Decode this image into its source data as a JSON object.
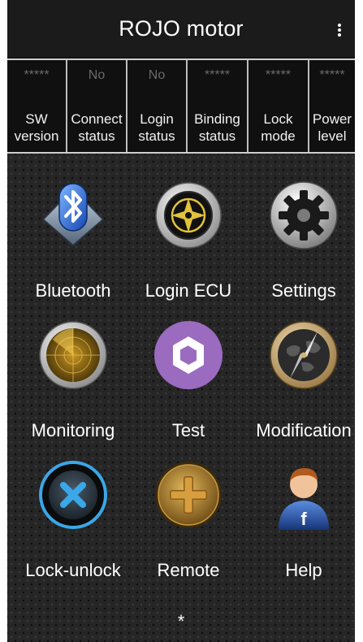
{
  "app": {
    "title": "ROJO motor"
  },
  "status": [
    {
      "value": "*****",
      "label_line1": "SW",
      "label_line2": "version"
    },
    {
      "value": "No",
      "label_line1": "Connect",
      "label_line2": "status"
    },
    {
      "value": "No",
      "label_line1": "Login",
      "label_line2": "status"
    },
    {
      "value": "*****",
      "label_line1": "Binding",
      "label_line2": "status"
    },
    {
      "value": "*****",
      "label_line1": "Lock",
      "label_line2": "mode"
    },
    {
      "value": "*****",
      "label_line1": "Power",
      "label_line2": "level"
    }
  ],
  "menu": [
    {
      "label": "Bluetooth",
      "icon": "bluetooth-icon"
    },
    {
      "label": "Login ECU",
      "icon": "compass-target-icon"
    },
    {
      "label": "Settings",
      "icon": "gear-icon"
    },
    {
      "label": "Monitoring",
      "icon": "radar-icon"
    },
    {
      "label": "Test",
      "icon": "aperture-icon"
    },
    {
      "label": "Modification",
      "icon": "world-compass-icon"
    },
    {
      "label": "Lock-unlock",
      "icon": "x-circle-icon"
    },
    {
      "label": "Remote",
      "icon": "plus-circle-icon"
    },
    {
      "label": "Help",
      "icon": "user-facebook-icon"
    }
  ],
  "footer": {
    "text": "*"
  },
  "colors": {
    "test_purple": "#9b6bbf",
    "lock_blue": "#3aa7e8",
    "remote_gold": "#c99a3a"
  }
}
